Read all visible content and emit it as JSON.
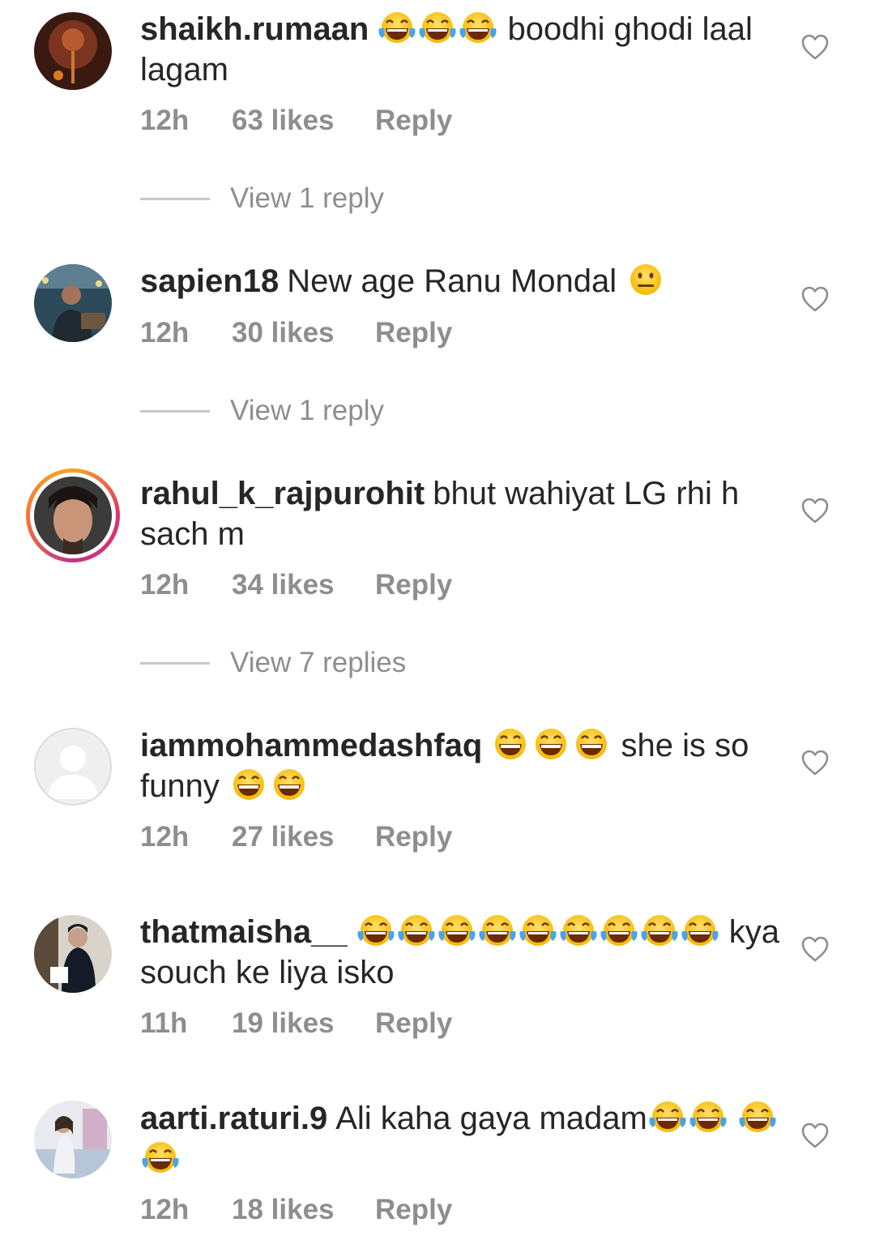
{
  "comments": [
    {
      "username": "shaikh.rumaan",
      "text_before": "",
      "emojis_before": "😂😂😂",
      "text": "boodhi ghodi laal lagam",
      "emojis_after": "",
      "time": "12h",
      "likes": "63 likes",
      "reply": "Reply",
      "view_replies": "View 1 reply"
    },
    {
      "username": "sapien18",
      "text": "New age Ranu Mondal",
      "emojis_after": "😐",
      "time": "12h",
      "likes": "30 likes",
      "reply": "Reply",
      "view_replies": "View 1 reply"
    },
    {
      "username": "rahul_k_rajpurohit",
      "text": "bhut wahiyat LG rhi h sach m",
      "time": "12h",
      "likes": "34 likes",
      "reply": "Reply",
      "view_replies": "View 7 replies"
    },
    {
      "username": "iammohammedashfaq",
      "emojis_before": "😄😄😄",
      "text": "she is so funny",
      "emojis_after": "😄😄",
      "time": "12h",
      "likes": "27 likes",
      "reply": "Reply"
    },
    {
      "username": "thatmaisha__",
      "emojis_before": "😂😂😂😂😂😂😂😂😂",
      "text": "kya souch ke liya isko",
      "time": "11h",
      "likes": "19 likes",
      "reply": "Reply"
    },
    {
      "username": "aarti.raturi.9",
      "text": "Ali kaha gaya madam",
      "emojis_after": "😂😂😂😂",
      "time": "12h",
      "likes": "18 likes",
      "reply": "Reply"
    }
  ],
  "colors": {
    "text": "#262626",
    "meta": "#8e8e8e",
    "divider": "#c7c7c7",
    "story_ring": "#e1306c"
  },
  "icons": {
    "like": "heart-outline-icon",
    "laugh": "face-with-tears-of-joy-icon",
    "grin": "grinning-face-icon",
    "neutral": "neutral-face-icon"
  }
}
